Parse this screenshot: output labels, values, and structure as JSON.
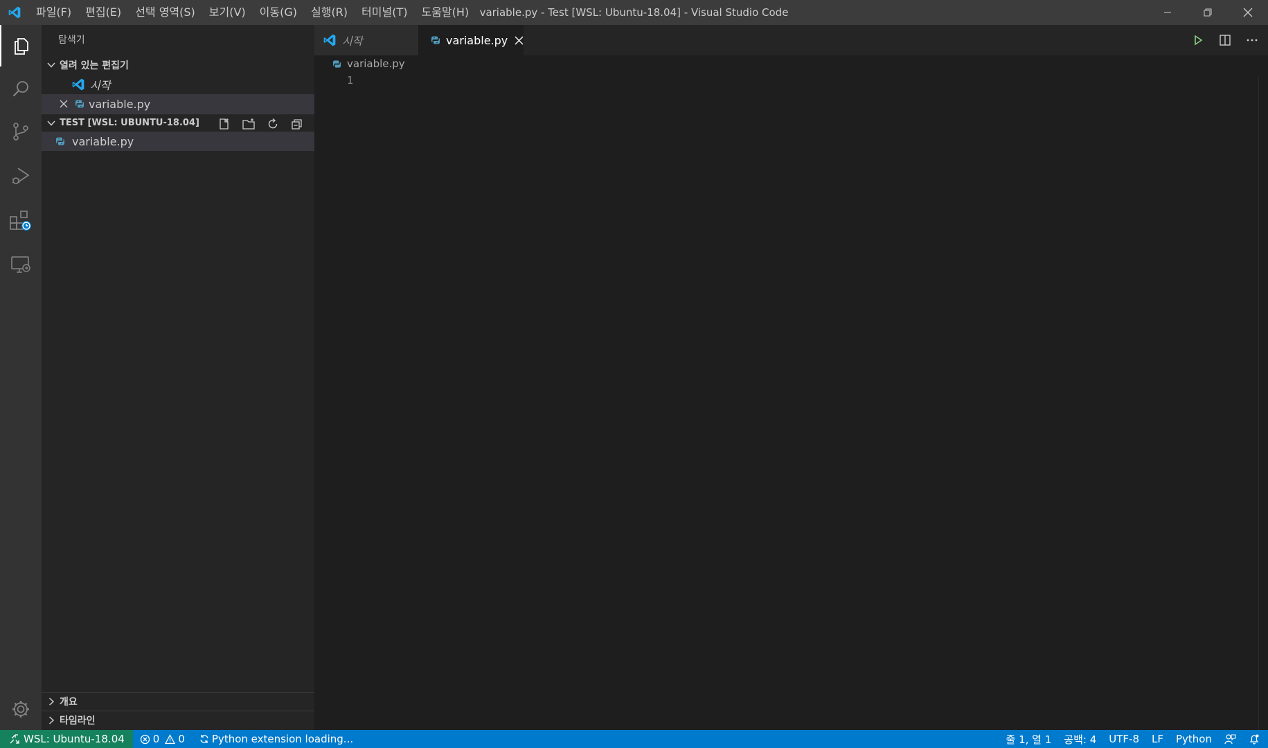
{
  "titlebar": {
    "menu": [
      "파일(F)",
      "편집(E)",
      "선택 영역(S)",
      "보기(V)",
      "이동(G)",
      "실행(R)",
      "터미널(T)",
      "도움말(H)"
    ],
    "window_title": "variable.py - Test [WSL: Ubuntu-18.04] - Visual Studio Code"
  },
  "activitybar": {
    "items": [
      "explorer-icon",
      "search-icon",
      "source-control-icon",
      "run-debug-icon",
      "extensions-icon",
      "remote-explorer-icon"
    ],
    "bottom": "gear-icon"
  },
  "sidebar": {
    "title": "탐색기",
    "open_editors": {
      "heading": "열려 있는 편집기",
      "items": [
        {
          "label": "시작",
          "icon": "vscode-icon"
        },
        {
          "label": "variable.py",
          "icon": "python-icon"
        }
      ]
    },
    "folder": {
      "heading": "TEST [WSL: UBUNTU-18.04]",
      "files": [
        "variable.py"
      ]
    },
    "outline": "개요",
    "timeline": "타임라인"
  },
  "editor": {
    "tabs": [
      {
        "label": "시작",
        "icon": "vscode-icon",
        "active": false
      },
      {
        "label": "variable.py",
        "icon": "python-icon",
        "active": true
      }
    ],
    "breadcrumb": "variable.py",
    "line_numbers": [
      "1"
    ]
  },
  "statusbar": {
    "remote": "WSL: Ubuntu-18.04",
    "errors": "0",
    "warnings": "0",
    "python_status": "Python extension loading...",
    "position": "줄 1, 열 1",
    "indent": "공백: 4",
    "encoding": "UTF-8",
    "eol": "LF",
    "language": "Python"
  },
  "colors": {
    "statusbar": "#007acc",
    "remote": "#16825d",
    "accent": "#0098ff",
    "python": "#519aba",
    "run": "#89d185"
  }
}
